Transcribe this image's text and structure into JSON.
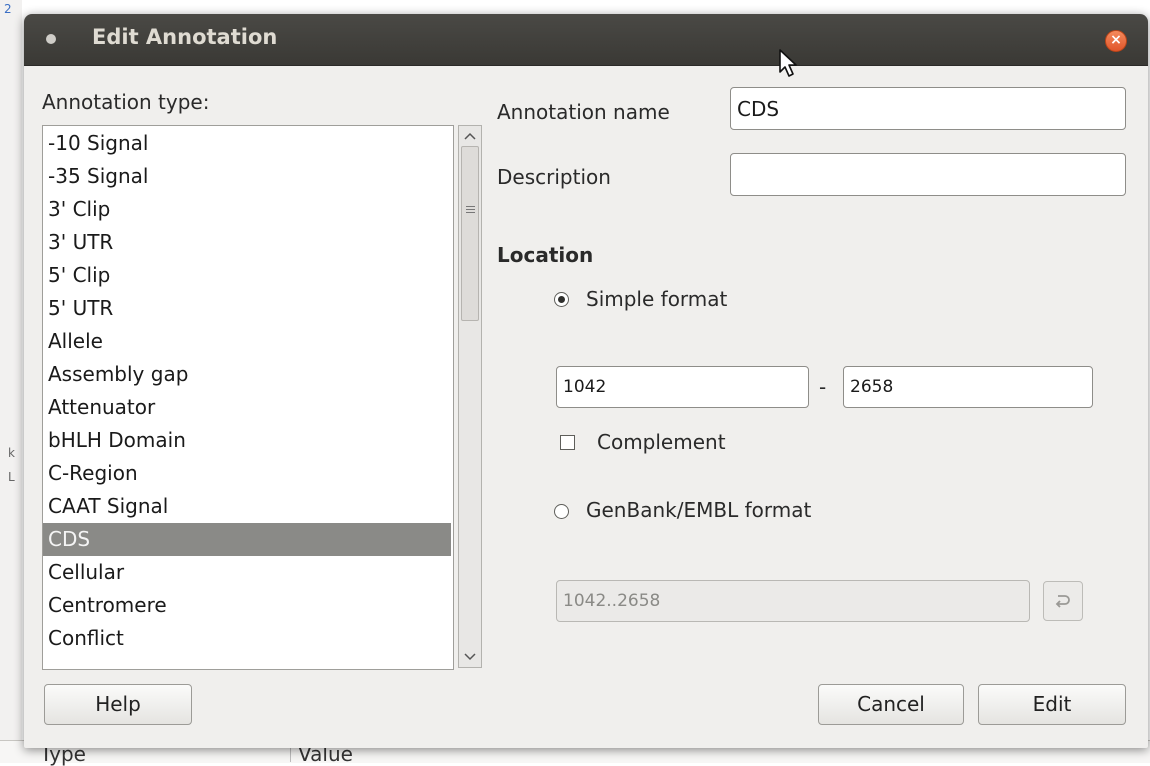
{
  "dialog": {
    "title": "Edit Annotation",
    "close_glyph": "×"
  },
  "background": {
    "table_headers": [
      "Type",
      "Value"
    ],
    "left_marks": [
      "2",
      "k",
      "L"
    ]
  },
  "annotation_type": {
    "label": "Annotation type:",
    "items": [
      "-10 Signal",
      "-35 Signal",
      "3' Clip",
      "3' UTR",
      "5' Clip",
      "5' UTR",
      "Allele",
      "Assembly gap",
      "Attenuator",
      "bHLH Domain",
      "C-Region",
      "CAAT Signal",
      "CDS",
      "Cellular",
      "Centromere",
      "Conflict"
    ],
    "selected": "CDS",
    "scroll_up_icon": "chevron-up-icon",
    "scroll_down_icon": "chevron-down-icon"
  },
  "form": {
    "name_label": "Annotation name",
    "name_value": "CDS",
    "description_label": "Description",
    "description_value": ""
  },
  "location": {
    "heading": "Location",
    "simple_format_label": "Simple format",
    "simple_selected": true,
    "start": "1042",
    "dash": "-",
    "end": "2658",
    "complement_label": "Complement",
    "complement_checked": false,
    "genbank_format_label": "GenBank/EMBL format",
    "genbank_value": "1042..2658",
    "genbank_apply_icon": "return-arrow-icon"
  },
  "buttons": {
    "help": "Help",
    "cancel": "Cancel",
    "edit": "Edit"
  }
}
